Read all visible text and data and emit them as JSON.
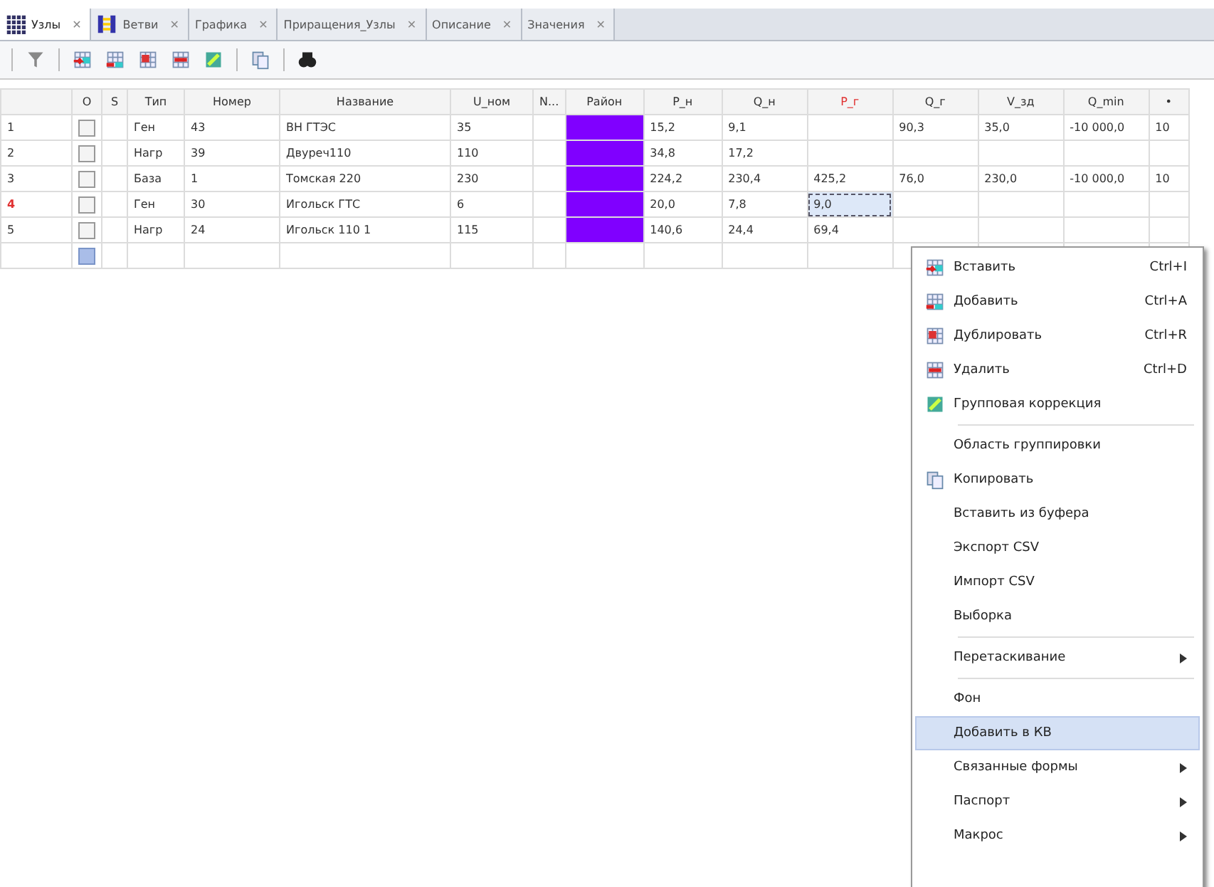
{
  "tabs": [
    {
      "label": "Узлы",
      "selected": true,
      "close": "✕"
    },
    {
      "label": "Ветви",
      "selected": false,
      "close": "✕"
    },
    {
      "label": "Графика",
      "selected": false,
      "close": "✕"
    },
    {
      "label": "Приращения_Узлы",
      "selected": false,
      "close": "✕"
    },
    {
      "label": "Описание",
      "selected": false,
      "close": "✕"
    },
    {
      "label": "Значения",
      "selected": false,
      "close": "✕"
    }
  ],
  "table": {
    "flag_columns": [
      "O",
      "S"
    ],
    "columns": [
      {
        "label": "Тип",
        "selected": false
      },
      {
        "label": "Номер",
        "selected": false
      },
      {
        "label": "Название",
        "selected": false
      },
      {
        "label": "U_ном",
        "selected": false
      },
      {
        "label": "N...",
        "selected": false
      },
      {
        "label": "Район",
        "selected": false
      },
      {
        "label": "P_н",
        "selected": false
      },
      {
        "label": "Q_н",
        "selected": false
      },
      {
        "label": "P_г",
        "selected": true
      },
      {
        "label": "Q_г",
        "selected": false
      },
      {
        "label": "V_зд",
        "selected": false
      },
      {
        "label": "Q_min",
        "selected": false
      },
      {
        "label": "•",
        "selected": false
      }
    ],
    "rows": [
      {
        "num": "1",
        "current": false,
        "checked": false,
        "color": "#8000ff",
        "cells": [
          "Ген",
          "43",
          "ВН ГТЭС",
          "35",
          "",
          "",
          "15,2",
          "9,1",
          "",
          "90,3",
          "35,0",
          "-10 000,0",
          "10"
        ]
      },
      {
        "num": "2",
        "current": false,
        "checked": false,
        "color": "#8000ff",
        "cells": [
          "Нагр",
          "39",
          "Двуреч110",
          "110",
          "",
          "",
          "34,8",
          "17,2",
          "",
          "",
          "",
          "",
          ""
        ]
      },
      {
        "num": "3",
        "current": false,
        "checked": false,
        "color": "#8000ff",
        "cells": [
          "База",
          "1",
          "Томская 220",
          "230",
          "",
          "",
          "224,2",
          "230,4",
          "425,2",
          "76,0",
          "230,0",
          "-10 000,0",
          "10"
        ]
      },
      {
        "num": "4",
        "current": true,
        "checked": false,
        "color": "#8000ff",
        "cells": [
          "Ген",
          "30",
          "Игольск ГТС",
          "6",
          "",
          "",
          "20,0",
          "7,8",
          "9,0",
          "",
          "",
          "",
          ""
        ]
      },
      {
        "num": "5",
        "current": false,
        "checked": false,
        "color": "#8000ff",
        "cells": [
          "Нагр",
          "24",
          "Игольск 110 1",
          "115",
          "",
          "",
          "140,6",
          "24,4",
          "69,4",
          "",
          "",
          "",
          ""
        ]
      }
    ]
  },
  "menu": [
    {
      "kind": "item",
      "label": "Вставить",
      "shortcut": "Ctrl+I",
      "selected": false
    },
    {
      "kind": "item",
      "label": "Добавить",
      "shortcut": "Ctrl+A",
      "selected": false
    },
    {
      "kind": "item",
      "label": "Дублировать",
      "shortcut": "Ctrl+R",
      "selected": false
    },
    {
      "kind": "item",
      "label": "Удалить",
      "shortcut": "Ctrl+D",
      "selected": false
    },
    {
      "kind": "item",
      "label": "Групповая коррекция",
      "selected": false
    },
    {
      "kind": "separator"
    },
    {
      "kind": "item",
      "label": "Область группировки",
      "selected": false
    },
    {
      "kind": "item",
      "label": "Копировать",
      "selected": false
    },
    {
      "kind": "item",
      "label": "Вставить из буфера",
      "selected": false
    },
    {
      "kind": "item",
      "label": "Экспорт CSV",
      "selected": false
    },
    {
      "kind": "item",
      "label": "Импорт CSV",
      "selected": false
    },
    {
      "kind": "item",
      "label": "Выборка",
      "selected": false
    },
    {
      "kind": "separator"
    },
    {
      "kind": "item",
      "label": "Перетаскивание",
      "submenu": true,
      "selected": false
    },
    {
      "kind": "separator"
    },
    {
      "kind": "item",
      "label": "Фон",
      "selected": false
    },
    {
      "kind": "item",
      "label": "Добавить в КВ",
      "selected": true
    },
    {
      "kind": "item",
      "label": "Связанные формы",
      "submenu": true,
      "selected": false
    },
    {
      "kind": "item",
      "label": "Паспорт",
      "submenu": true,
      "selected": false
    },
    {
      "kind": "item",
      "label": "Макрос",
      "submenu": true,
      "selected": false
    }
  ]
}
